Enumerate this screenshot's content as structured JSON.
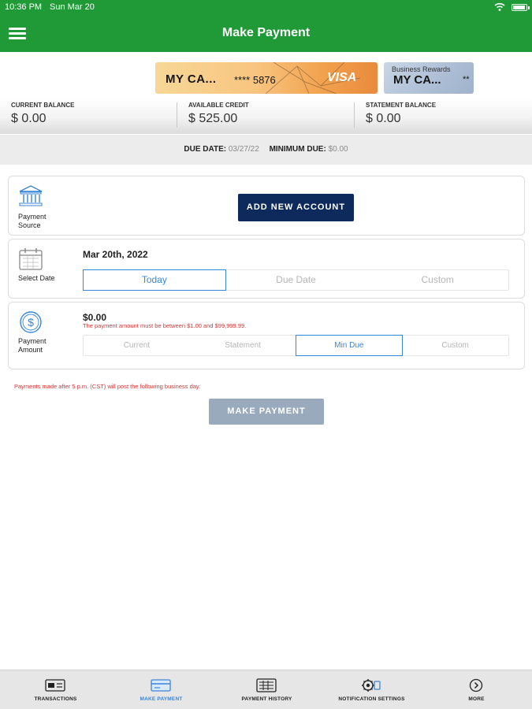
{
  "status": {
    "time": "10:36 PM",
    "date": "Sun Mar 20"
  },
  "header": {
    "title": "Make Payment"
  },
  "cards": [
    {
      "name": "MY CA...",
      "number": "**** 5876",
      "network": "VISA"
    },
    {
      "brand": "Business Rewards",
      "name": "MY CA...",
      "number": "**"
    }
  ],
  "balances": {
    "current_label": "CURRENT BALANCE",
    "current_value": "$ 0.00",
    "available_label": "AVAILABLE CREDIT",
    "available_value": "$ 525.00",
    "statement_label": "STATEMENT BALANCE",
    "statement_value": "$ 0.00"
  },
  "due": {
    "due_date_label": "DUE DATE:",
    "due_date_value": "03/27/22",
    "minimum_label": "MINIMUM DUE:",
    "minimum_value": "$0.00"
  },
  "payment_source": {
    "label_line1": "Payment",
    "label_line2": "Source",
    "add_button": "ADD NEW ACCOUNT"
  },
  "select_date": {
    "label": "Select Date",
    "value": "Mar 20th, 2022",
    "options": [
      "Today",
      "Due Date",
      "Custom"
    ],
    "selected": "Today"
  },
  "payment_amount": {
    "label_line1": "Payment",
    "label_line2": "Amount",
    "value": "$0.00",
    "error": "The payment amount must be between $1.00 and $99,999.99.",
    "options": [
      "Current",
      "Statement",
      "Min Due",
      "Custom"
    ],
    "selected": "Min Due"
  },
  "note": "Payments made after 5 p.m. (CST) will post the following business day.",
  "make_payment_button": "MAKE PAYMENT",
  "tabs": [
    {
      "label": "TRANSACTIONS",
      "icon": "transactions-icon"
    },
    {
      "label": "MAKE PAYMENT",
      "icon": "make-payment-icon",
      "active": true
    },
    {
      "label": "PAYMENT HISTORY",
      "icon": "payment-history-icon"
    },
    {
      "label": "NOTIFICATION SETTINGS",
      "icon": "notification-settings-icon"
    },
    {
      "label": "MORE",
      "icon": "more-icon"
    }
  ],
  "colors": {
    "header_green": "#1f9a37",
    "primary_navy": "#0e2a5c",
    "accent_blue": "#3a86d6",
    "error_red": "#d63434"
  }
}
